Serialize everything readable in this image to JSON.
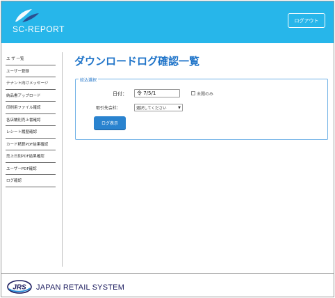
{
  "header": {
    "logo_text": "SC-REPORT",
    "logout_label": "ログアウト",
    "brand_color": "#27b6ea",
    "logo_icon": "feather-logo-icon"
  },
  "sidebar": {
    "items": [
      {
        "label": "ユ ザ 一覧"
      },
      {
        "label": "ユーザー登録"
      },
      {
        "label": "テナント向けメッセージ"
      },
      {
        "label": "納品書アップロード"
      },
      {
        "label": "印刷用ファイル確認"
      },
      {
        "label": "各店舗別売上書確認"
      },
      {
        "label": "レシート履歴確認"
      },
      {
        "label": "カード精算PDF結果確認"
      },
      {
        "label": "売上日別PDF結果確認"
      },
      {
        "label": "ユーザーPDF確認"
      },
      {
        "label": "ログ確認"
      }
    ]
  },
  "main": {
    "title": "ダウンロードログ確認一覧",
    "filter": {
      "legend": "絞込選択",
      "date_label": "日付：",
      "date_value": "令 7/5/1",
      "unconfirmed_label": "未閲のみ",
      "company_label": "取引先会社：",
      "company_value": "選択してください",
      "show_log_label": "ログ表示"
    },
    "accent_color": "#2175c9",
    "button_color": "#2a83cf"
  },
  "footer": {
    "company_text": "JAPAN RETAIL SYSTEM",
    "logo_text": "JRS",
    "logo_icon": "jrs-logo-icon"
  }
}
